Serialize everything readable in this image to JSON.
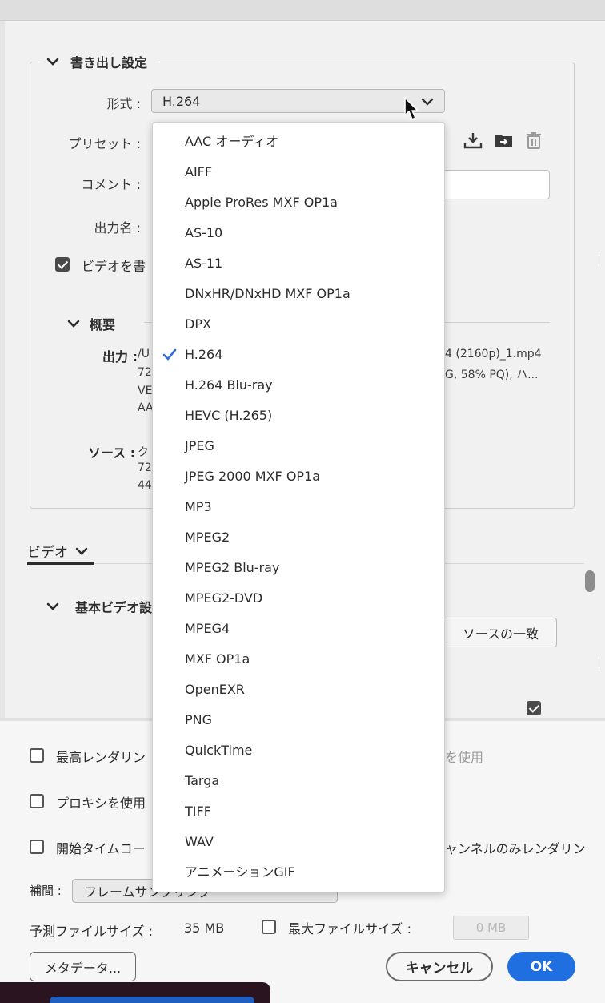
{
  "export_settings": {
    "title": "書き出し設定",
    "format_label": "形式 :",
    "format_value": "H.264",
    "preset_label": "プリセット :",
    "comment_label": "コメント :",
    "output_name_label": "出力名 :",
    "export_video_label": "ビデオを書",
    "summary_title": "概要",
    "summary": {
      "output_label": "出力 :",
      "output_line1_a": "/U",
      "output_line1_b": "4 (2160p)_1.mp4",
      "output_line2_a": "72",
      "output_line2_b": "G, 58% PQ), ハ...",
      "output_line3": "VE",
      "output_line4": "AA",
      "source_label": "ソース :",
      "source_line1": "ク",
      "source_line2": "72",
      "source_line3": "44"
    }
  },
  "tabs": {
    "video_tab": "ビデオ"
  },
  "basic_video": {
    "title": "基本ビデオ設",
    "match_source": "ソースの一致"
  },
  "bottom": {
    "max_render_quality": "最高レンダリン",
    "use_previews_partial": "を使用",
    "use_proxies": "プロキシを使用",
    "start_timecode": "開始タイムコー",
    "render_alpha_partial": "ャンネルのみレンダリン",
    "interpolation_label": "補間 :",
    "interpolation_value": "フレームサンプリング",
    "estimated_size_label": "予測ファイルサイズ :",
    "estimated_size_value": "35 MB",
    "max_file_size_label": "最大ファイルサイズ :",
    "max_file_size_placeholder": "0 MB",
    "metadata_button": "メタデータ...",
    "cancel_button": "キャンセル",
    "ok_button": "OK"
  },
  "format_dropdown": {
    "selected": "H.264",
    "options": [
      "AAC オーディオ",
      "AIFF",
      "Apple ProRes MXF OP1a",
      "AS-10",
      "AS-11",
      "DNxHR/DNxHD MXF OP1a",
      "DPX",
      "H.264",
      "H.264 Blu-ray",
      "HEVC (H.265)",
      "JPEG",
      "JPEG 2000 MXF OP1a",
      "MP3",
      "MPEG2",
      "MPEG2 Blu-ray",
      "MPEG2-DVD",
      "MPEG4",
      "MXF OP1a",
      "OpenEXR",
      "PNG",
      "QuickTime",
      "Targa",
      "TIFF",
      "WAV",
      "アニメーションGIF"
    ]
  },
  "colors": {
    "accent": "#1f6fe0",
    "check_mark": "#2f6fdc"
  }
}
